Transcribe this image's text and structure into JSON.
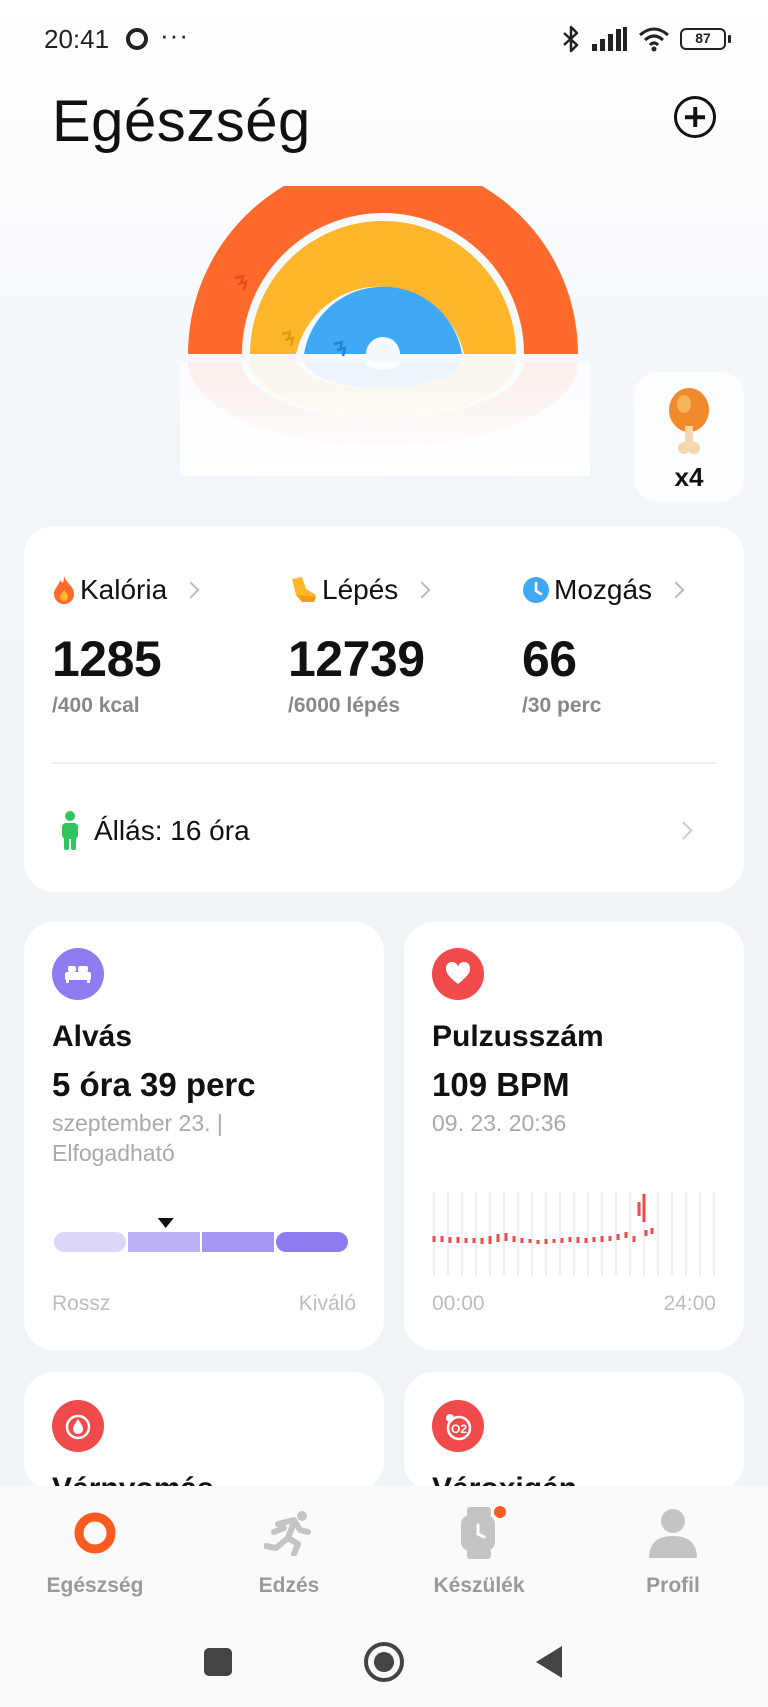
{
  "status_bar": {
    "time": "20:41",
    "dots": "···",
    "battery": "87"
  },
  "header": {
    "title": "Egészség"
  },
  "rings": {
    "colors": {
      "outer": "#FF6A2C",
      "middle": "#FFB62B",
      "inner": "#3FA9F5"
    },
    "reward_icon": "chicken-drumstick-icon",
    "reward_count": "x4"
  },
  "activity": {
    "metrics": [
      {
        "label": "Kalória",
        "value": "1285",
        "goal": "/400 kcal",
        "icon": "flame-icon",
        "color": "#FF6A2C"
      },
      {
        "label": "Lépés",
        "value": "12739",
        "goal": "/6000 lépés",
        "icon": "shoe-icon",
        "color": "#FFB62B"
      },
      {
        "label": "Mozgás",
        "value": "66",
        "goal": "/30 perc",
        "icon": "clock-icon",
        "color": "#3FA9F5"
      }
    ],
    "standing": "Állás: 16 óra"
  },
  "sleep": {
    "title": "Alvás",
    "value": "5 óra 39 perc",
    "sub": "szeptember 23. | Elfogadható",
    "scale_left": "Rossz",
    "scale_right": "Kiváló",
    "quality_fraction": 0.38,
    "color": "#8F7CF0"
  },
  "heart": {
    "title": "Pulzusszám",
    "value": "109 BPM",
    "sub": "09. 23. 20:36",
    "axis_start": "00:00",
    "axis_end": "24:00",
    "color": "#F04A4A"
  },
  "partial_cards": {
    "bp_title": "Vérnyomás",
    "o2_title": "Véroxigén",
    "o2_badge": "O2"
  },
  "bottom_nav": {
    "items": [
      {
        "label": "Egészség",
        "icon": "health-ring-icon"
      },
      {
        "label": "Edzés",
        "icon": "running-icon"
      },
      {
        "label": "Készülék",
        "icon": "watch-icon"
      },
      {
        "label": "Profil",
        "icon": "person-icon"
      }
    ],
    "active_color": "#FF5A1F"
  }
}
